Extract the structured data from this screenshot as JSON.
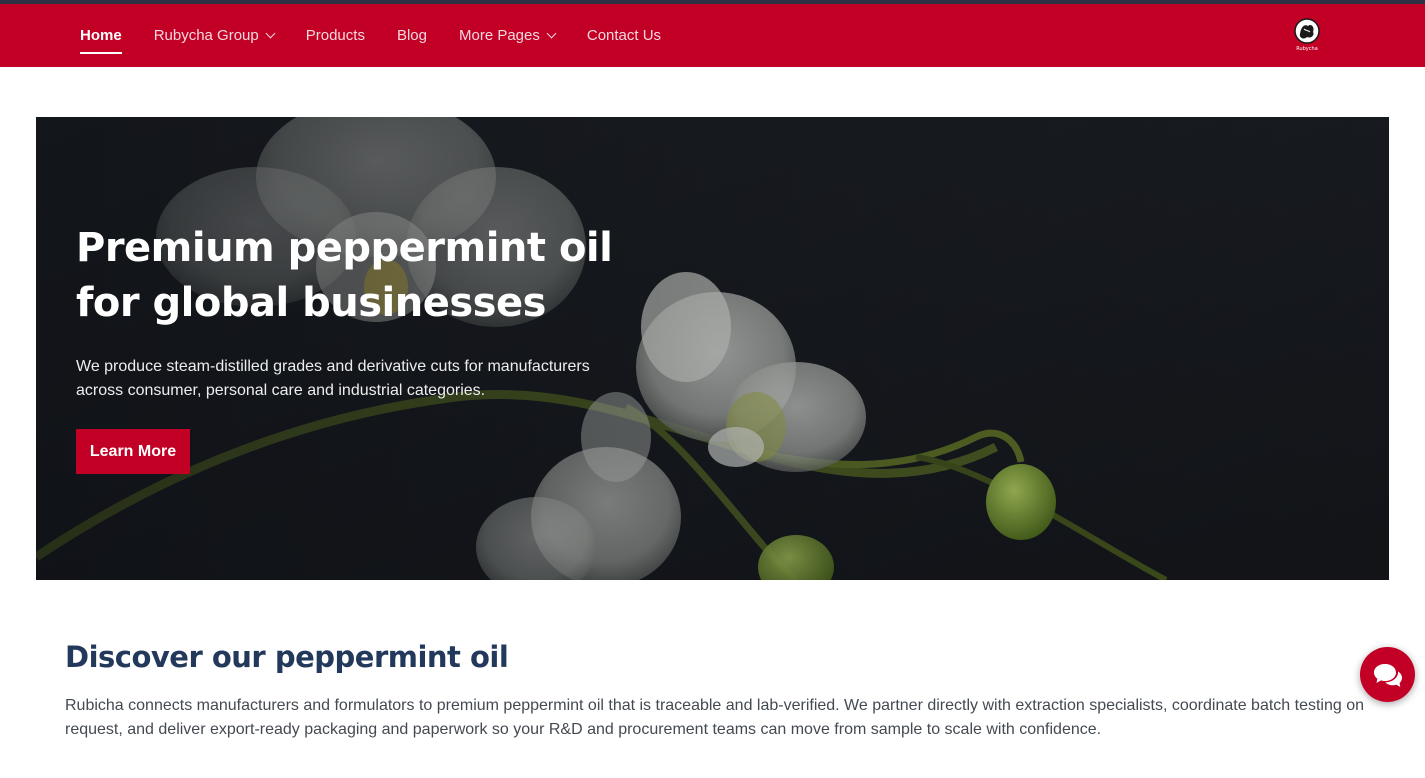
{
  "nav": {
    "items": [
      {
        "label": "Home",
        "active": true,
        "dropdown": false
      },
      {
        "label": "Rubycha Group",
        "active": false,
        "dropdown": true
      },
      {
        "label": "Products",
        "active": false,
        "dropdown": false
      },
      {
        "label": "Blog",
        "active": false,
        "dropdown": false
      },
      {
        "label": "More Pages",
        "active": false,
        "dropdown": true
      },
      {
        "label": "Contact Us",
        "active": false,
        "dropdown": false
      }
    ],
    "logo_text": "Rubycha"
  },
  "hero": {
    "title": "Premium peppermint oil for global businesses",
    "text": "We produce steam-distilled grades and derivative cuts for manufacturers across consumer, personal care and industrial categories.",
    "button_label": "Learn More"
  },
  "section": {
    "title": "Discover our peppermint oil",
    "text": "Rubicha connects manufacturers and formulators to premium peppermint oil that is traceable and lab-verified. We partner directly with extraction specialists, coordinate batch testing on request, and deliver export-ready packaging and paperwork so your R&D and procurement teams can move from sample to scale with confidence."
  },
  "chat": {
    "icon": "chat-bubbles-icon"
  },
  "colors": {
    "brand": "#c20026",
    "heading": "#23395b",
    "text": "#444a52"
  }
}
